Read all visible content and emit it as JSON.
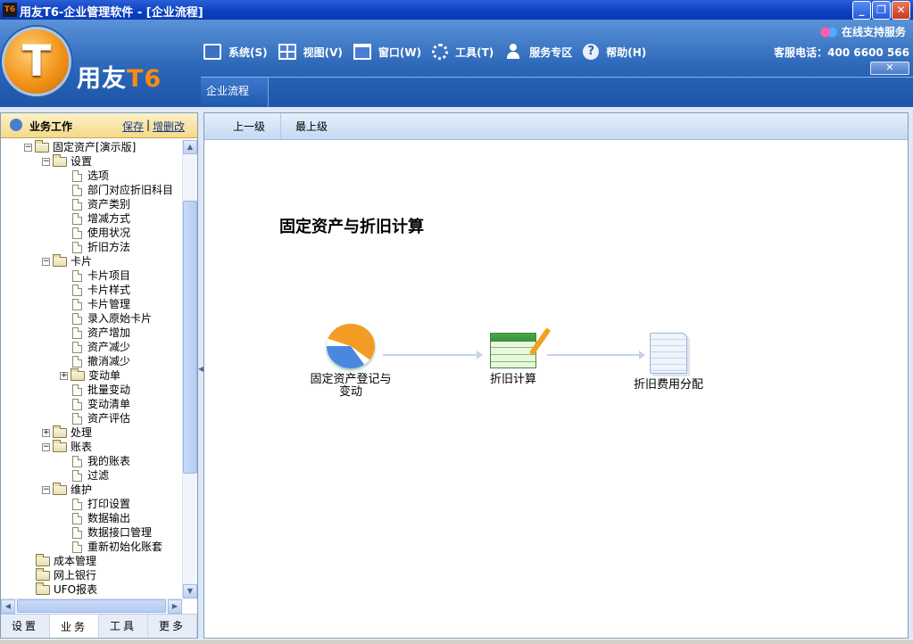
{
  "window": {
    "title": "用友T6-企业管理软件 - [企业流程]",
    "app_icon_text": "T6"
  },
  "header": {
    "logo_glyph": "T",
    "brand_prefix": "用友",
    "brand_t6": "T6",
    "menu": [
      {
        "label": "系统(S)",
        "icon": "monitor-icon"
      },
      {
        "label": "视图(V)",
        "icon": "grid-icon"
      },
      {
        "label": "窗口(W)",
        "icon": "window-icon"
      },
      {
        "label": "工具(T)",
        "icon": "gear-icon"
      },
      {
        "label": "服务专区",
        "icon": "person-icon"
      },
      {
        "label": "帮助(H)",
        "icon": "help-icon"
      }
    ],
    "online_support": "在线支持服务",
    "hotline": "客服电话：400 6600 566",
    "close_glyph": "✕",
    "active_tab": "企业流程"
  },
  "left_panel": {
    "title": "业务工作",
    "save": "保存",
    "separator": "|",
    "add_delete": "增删改",
    "tree": [
      {
        "label": "固定资产[演示版]",
        "type": "folder",
        "level": 1,
        "expander": "−"
      },
      {
        "label": "设置",
        "type": "folder",
        "level": 2,
        "expander": "−"
      },
      {
        "label": "选项",
        "type": "doc",
        "level": 3
      },
      {
        "label": "部门对应折旧科目",
        "type": "doc",
        "level": 3
      },
      {
        "label": "资产类别",
        "type": "doc",
        "level": 3
      },
      {
        "label": "增减方式",
        "type": "doc",
        "level": 3
      },
      {
        "label": "使用状况",
        "type": "doc",
        "level": 3
      },
      {
        "label": "折旧方法",
        "type": "doc",
        "level": 3
      },
      {
        "label": "卡片",
        "type": "folder",
        "level": 2,
        "expander": "−"
      },
      {
        "label": "卡片项目",
        "type": "doc",
        "level": 3
      },
      {
        "label": "卡片样式",
        "type": "doc",
        "level": 3
      },
      {
        "label": "卡片管理",
        "type": "doc",
        "level": 3
      },
      {
        "label": "录入原始卡片",
        "type": "doc",
        "level": 3
      },
      {
        "label": "资产增加",
        "type": "doc",
        "level": 3
      },
      {
        "label": "资产减少",
        "type": "doc",
        "level": 3
      },
      {
        "label": "撤消减少",
        "type": "doc",
        "level": 3
      },
      {
        "label": "变动单",
        "type": "folder",
        "level": 3,
        "expander": "+"
      },
      {
        "label": "批量变动",
        "type": "doc",
        "level": 3
      },
      {
        "label": "变动清单",
        "type": "doc",
        "level": 3
      },
      {
        "label": "资产评估",
        "type": "doc",
        "level": 3
      },
      {
        "label": "处理",
        "type": "folder",
        "level": 2,
        "expander": "+"
      },
      {
        "label": "账表",
        "type": "folder",
        "level": 2,
        "expander": "−"
      },
      {
        "label": "我的账表",
        "type": "doc",
        "level": 3
      },
      {
        "label": "过滤",
        "type": "doc",
        "level": 3
      },
      {
        "label": "维护",
        "type": "folder",
        "level": 2,
        "expander": "−"
      },
      {
        "label": "打印设置",
        "type": "doc",
        "level": 3
      },
      {
        "label": "数据输出",
        "type": "doc",
        "level": 3
      },
      {
        "label": "数据接口管理",
        "type": "doc",
        "level": 3
      },
      {
        "label": "重新初始化账套",
        "type": "doc",
        "level": 3
      },
      {
        "label": "成本管理",
        "type": "folder",
        "level": 1
      },
      {
        "label": "网上银行",
        "type": "folder",
        "level": 1
      },
      {
        "label": "UFO报表",
        "type": "folder",
        "level": 1
      }
    ],
    "bottom_tabs": [
      "设置",
      "业务",
      "工具",
      "更多"
    ],
    "active_bottom_tab": "业务"
  },
  "toolbar": {
    "up_one_level": "上一级",
    "top_level": "最上级"
  },
  "flow": {
    "title": "固定资产与折旧计算",
    "nodes": [
      {
        "label_line1": "固定资产登记与",
        "label_line2": "变动",
        "icon": "asset-register-icon"
      },
      {
        "label_line1": "折旧计算",
        "label_line2": "",
        "icon": "depreciation-calc-icon"
      },
      {
        "label_line1": "折旧费用分配",
        "label_line2": "",
        "icon": "depreciation-allocation-icon"
      }
    ]
  }
}
